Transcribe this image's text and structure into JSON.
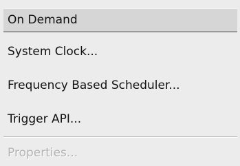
{
  "menu": {
    "items": [
      {
        "label": "On Demand",
        "state": "selected"
      },
      {
        "label": "System Clock...",
        "state": "normal"
      },
      {
        "label": "Frequency Based Scheduler...",
        "state": "normal"
      },
      {
        "label": "Trigger API...",
        "state": "normal"
      },
      {
        "label": "Properties...",
        "state": "disabled"
      }
    ]
  }
}
